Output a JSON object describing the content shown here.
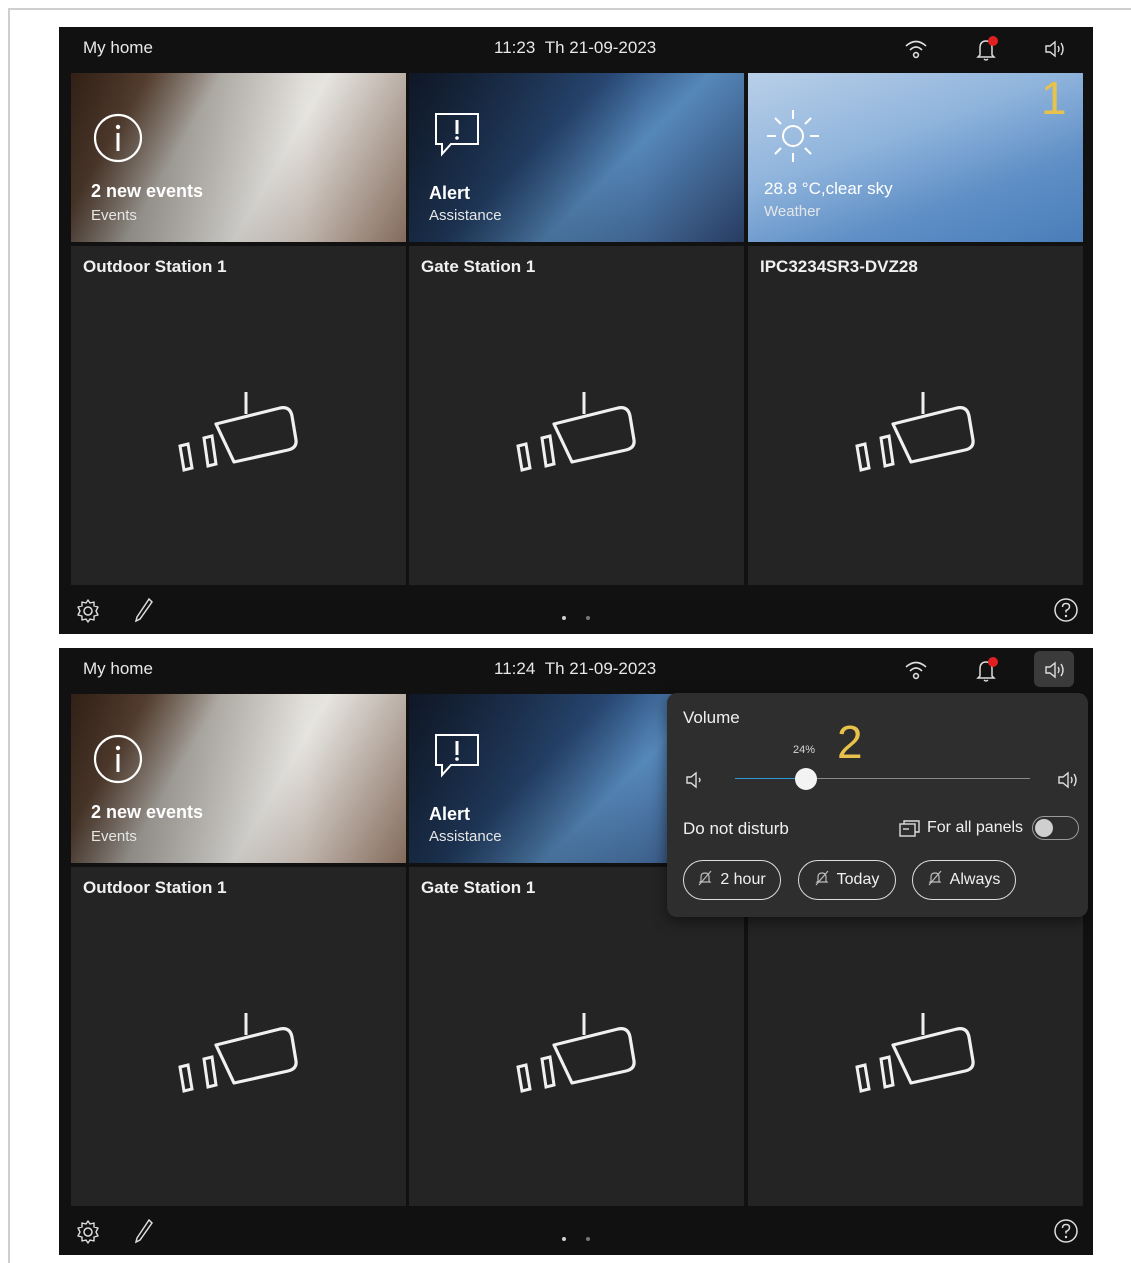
{
  "screens": [
    {
      "header": {
        "title": "My home",
        "time": "11:23",
        "date": "Th 21-09-2023"
      },
      "marker": "1",
      "tiles": [
        {
          "title": "2 new events",
          "subtitle": "Events",
          "icon": "info-icon"
        },
        {
          "title": "Alert",
          "subtitle": "Assistance",
          "icon": "alert-bubble-icon"
        },
        {
          "title": "28.8 °C,clear sky",
          "subtitle": "Weather",
          "icon": "sun-icon"
        }
      ],
      "cameras": [
        {
          "name": "Outdoor Station 1"
        },
        {
          "name": "Gate Station  1"
        },
        {
          "name": "IPC3234SR3-DVZ28"
        }
      ],
      "page_dots": 2,
      "active_page": 1
    },
    {
      "header": {
        "title": "My home",
        "time": "11:24",
        "date": "Th 21-09-2023"
      },
      "marker": "2",
      "tiles": [
        {
          "title": "2 new events",
          "subtitle": "Events",
          "icon": "info-icon"
        },
        {
          "title": "Alert",
          "subtitle": "Assistance",
          "icon": "alert-bubble-icon"
        }
      ],
      "cameras": [
        {
          "name": "Outdoor Station 1"
        },
        {
          "name": "Gate Station  1"
        },
        {
          "name": ""
        }
      ],
      "volume_popup": {
        "title": "Volume",
        "level_label": "24%",
        "level": 0.24,
        "dnd_label": "Do not disturb",
        "all_panels_label": "For all panels",
        "all_panels_enabled": false,
        "durations": [
          "2 hour",
          "Today",
          "Always"
        ]
      },
      "page_dots": 2,
      "active_page": 1
    }
  ],
  "colors": {
    "marker": "#e8c24a",
    "notification_dot": "#e02020",
    "slider_fill": "#2f9ad6"
  },
  "icons": {
    "wifi": "wifi-icon",
    "bell": "bell-icon",
    "speaker": "speaker-icon",
    "settings": "gear-icon",
    "edit": "pen-icon",
    "help": "help-icon"
  }
}
